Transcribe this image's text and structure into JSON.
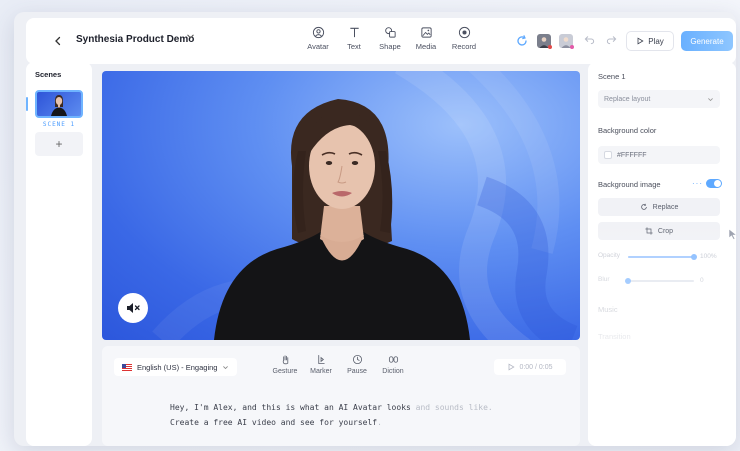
{
  "topbar": {
    "back_icon": "chevron-left-icon",
    "title": "Synthesia Product Demo",
    "tools": [
      {
        "label": "Avatar",
        "icon": "avatar-icon"
      },
      {
        "label": "Text",
        "icon": "text-icon"
      },
      {
        "label": "Shape",
        "icon": "shape-icon"
      },
      {
        "label": "Media",
        "icon": "media-icon"
      },
      {
        "label": "Record",
        "icon": "record-icon"
      }
    ],
    "play_label": "Play",
    "generate_label": "Generate",
    "colors": {
      "generate": "#7cbcff",
      "accent": "#5ea9ff"
    }
  },
  "scenes": {
    "title": "Scenes",
    "items": [
      {
        "label": "SCENE 1"
      }
    ],
    "add_label": "+"
  },
  "script": {
    "language": "English (US) - Engaging",
    "tools": [
      {
        "label": "Gesture"
      },
      {
        "label": "Marker"
      },
      {
        "label": "Pause"
      },
      {
        "label": "Diction"
      }
    ],
    "time": "0:00 / 0:05",
    "line1": "Hey, I'm Alex, and this is what an AI Avatar looks",
    "line1_fade": " and sounds like.",
    "line2": "Create a free AI video and see for yourself",
    "line2_fade": "."
  },
  "properties": {
    "scene_title": "Scene 1",
    "layout_placeholder": "Replace layout",
    "background_color_label": "Background color",
    "background_color_value": "#FFFFFF",
    "background_image_label": "Background image",
    "background_image_enabled": true,
    "replace_label": "Replace",
    "crop_label": "Crop",
    "opacity_label": "Opacity",
    "opacity_value": "100%",
    "opacity_level": 1.0,
    "blur_label": "Blur",
    "blur_value": "0",
    "blur_level": 0.0,
    "music_label": "Music",
    "transition_label": "Transition"
  }
}
